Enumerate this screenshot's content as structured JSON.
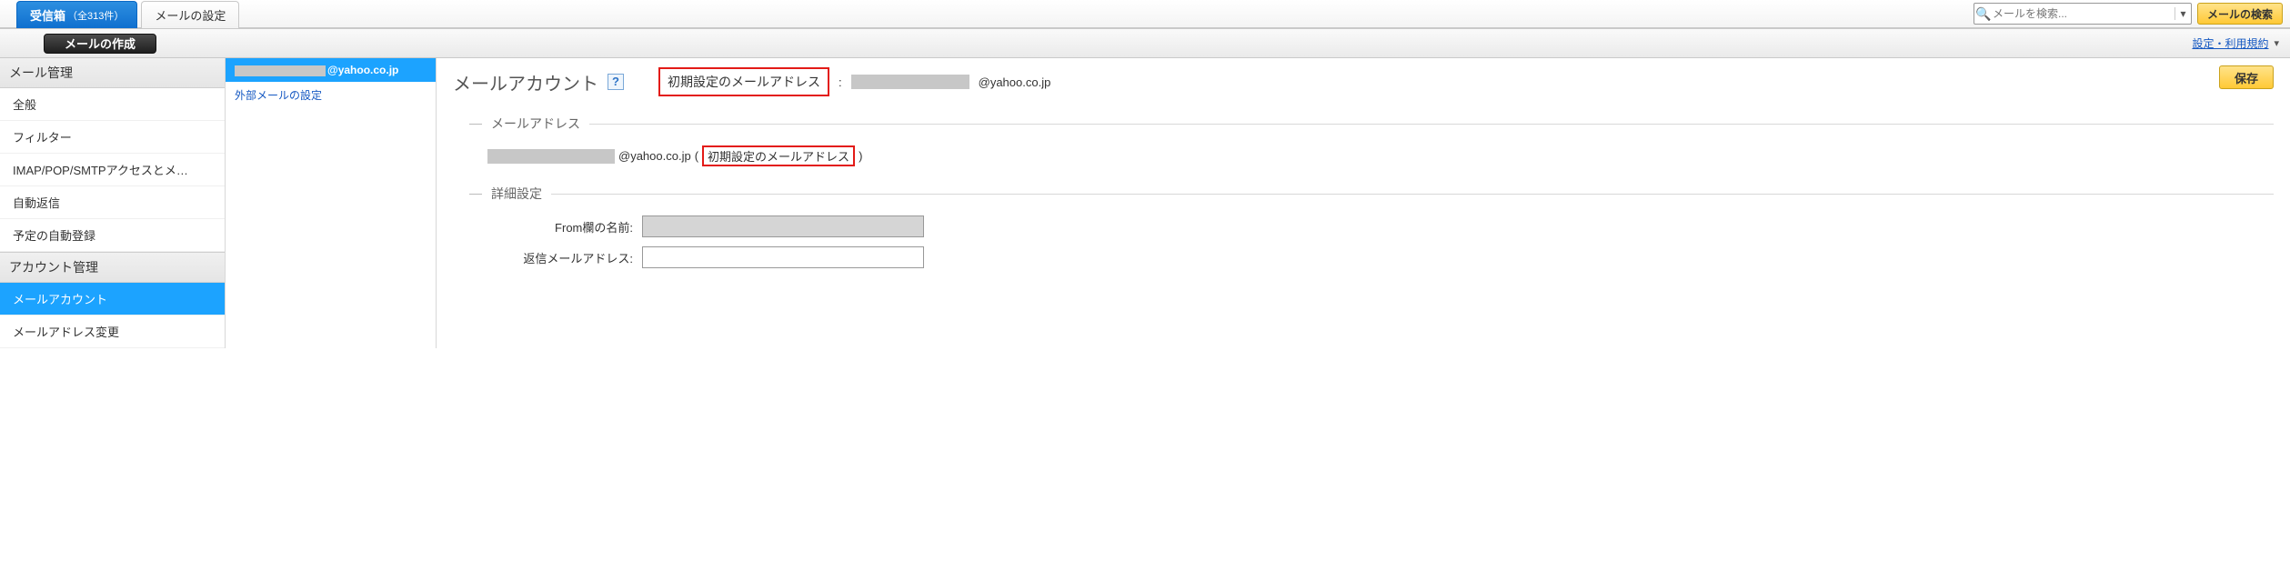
{
  "top": {
    "tabs": [
      {
        "label": "受信箱",
        "sub": "（全313件）"
      },
      {
        "label": "メールの設定"
      }
    ],
    "search_placeholder": "メールを検索...",
    "search_button": "メールの検索"
  },
  "compose_bar": {
    "compose": "メールの作成",
    "settings_link": "設定・利用規約"
  },
  "sidebar": {
    "sections": [
      {
        "header": "メール管理",
        "items": [
          "全般",
          "フィルター",
          "IMAP/POP/SMTPアクセスとメ…",
          "自動返信",
          "予定の自動登録"
        ]
      },
      {
        "header": "アカウント管理",
        "items": [
          "メールアカウント",
          "メールアドレス変更"
        ]
      }
    ]
  },
  "accounts": {
    "items": [
      {
        "suffix": "@yahoo.co.jp",
        "selected": true
      },
      {
        "label": "外部メールの設定",
        "selected": false
      }
    ]
  },
  "main": {
    "title": "メールアカウント",
    "help": "?",
    "default_label": "初期設定のメールアドレス",
    "default_colon": ":",
    "default_domain": "@yahoo.co.jp",
    "save": "保存",
    "section_mailaddr": "メールアドレス",
    "address_domain": "@yahoo.co.jp",
    "address_note": "初期設定のメールアドレス",
    "section_detail": "詳細設定",
    "from_label": "From欄の名前:",
    "reply_label": "返信メールアドレス:",
    "reply_value": ""
  }
}
